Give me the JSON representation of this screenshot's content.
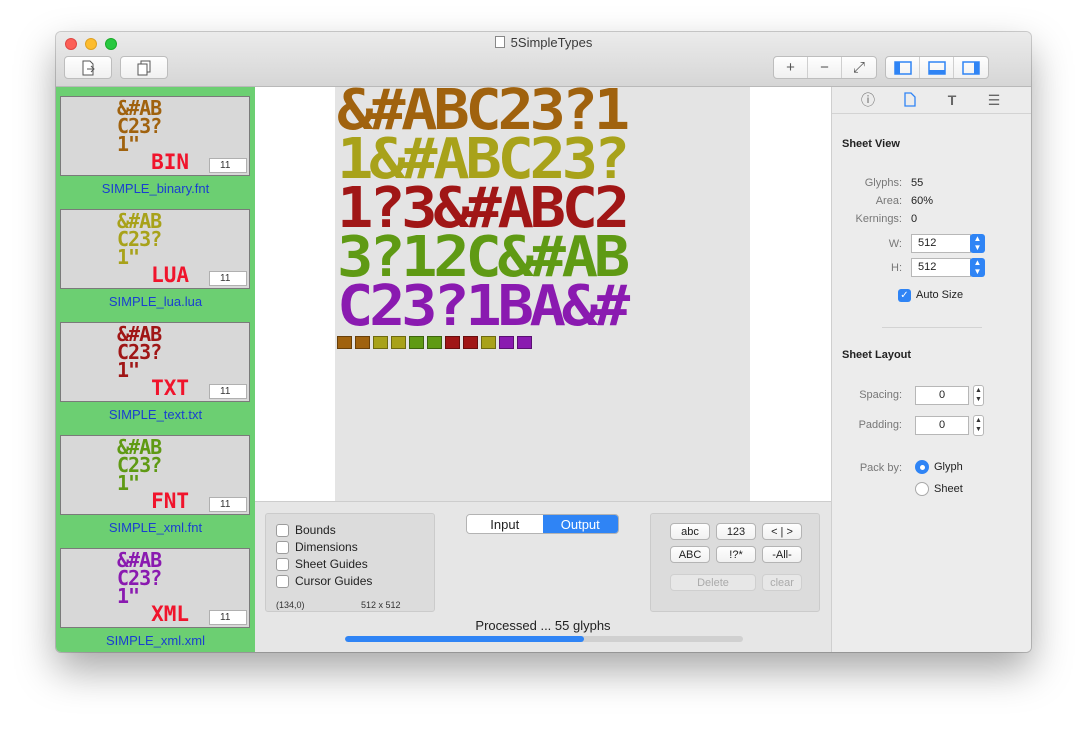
{
  "window": {
    "title": "5SimpleTypes"
  },
  "toolbar": {
    "export_icon": "export-icon",
    "duplicate_icon": "duplicate-icon",
    "zoom_in": "+",
    "zoom_out": "−",
    "zoom_fit": "⤢"
  },
  "sidebar": {
    "items": [
      {
        "label": "SIMPLE_binary.fnt",
        "tag": "BIN",
        "count": "11",
        "color": "#a0620e"
      },
      {
        "label": "SIMPLE_lua.lua",
        "tag": "LUA",
        "count": "11",
        "color": "#a8a21a"
      },
      {
        "label": "SIMPLE_text.txt",
        "tag": "TXT",
        "count": "11",
        "color": "#a01616"
      },
      {
        "label": "SIMPLE_xml.fnt",
        "tag": "FNT",
        "count": "11",
        "color": "#5f9a14"
      },
      {
        "label": "SIMPLE_xml.xml",
        "tag": "XML",
        "count": "11",
        "color": "#8a1ab0"
      }
    ],
    "thumb_lines": [
      "&#AB",
      "C23?",
      "1\""
    ]
  },
  "sheet": {
    "rows": [
      {
        "text": "&#ABC23?1",
        "color": "#a0620e"
      },
      {
        "text": "1&#ABC23?",
        "color": "#a8a21a"
      },
      {
        "text": "1?3&#ABC2",
        "color": "#a01616"
      },
      {
        "text": "3?12C&#AB",
        "color": "#5f9a14"
      },
      {
        "text": "C23?1BA&#",
        "color": "#8a1ab0"
      }
    ],
    "squares": [
      "#a0620e",
      "#a0620e",
      "#a8a21a",
      "#a8a21a",
      "#5f9a14",
      "#5f9a14",
      "#a01616",
      "#a01616",
      "#a8a21a",
      "#8a1ab0",
      "#8a1ab0"
    ]
  },
  "view_options": {
    "bounds": "Bounds",
    "dimensions": "Dimensions",
    "sheet_guides": "Sheet Guides",
    "cursor_guides": "Cursor Guides",
    "cursor_pos": "(134,0)",
    "sheet_size": "512 x 512"
  },
  "io_toggle": {
    "input": "Input",
    "output": "Output"
  },
  "glyph_buttons": {
    "abc": "abc",
    "n123": "123",
    "brackets": "< | >",
    "ABC": "ABC",
    "punct": "!?*",
    "all": "-All-",
    "delete": "Delete",
    "clear": "clear"
  },
  "status": {
    "text": "Processed ... 55 glyphs",
    "progress": 0.6
  },
  "inspector": {
    "sheet_view_title": "Sheet View",
    "glyphs_label": "Glyphs:",
    "glyphs_value": "55",
    "area_label": "Area:",
    "area_value": "60%",
    "kernings_label": "Kernings:",
    "kernings_value": "0",
    "w_label": "W:",
    "w_value": "512",
    "h_label": "H:",
    "h_value": "512",
    "auto_size": "Auto Size",
    "sheet_layout_title": "Sheet Layout",
    "spacing_label": "Spacing:",
    "spacing_value": "0",
    "padding_label": "Padding:",
    "padding_value": "0",
    "pack_by_label": "Pack by:",
    "pack_glyph": "Glyph",
    "pack_sheet": "Sheet"
  }
}
